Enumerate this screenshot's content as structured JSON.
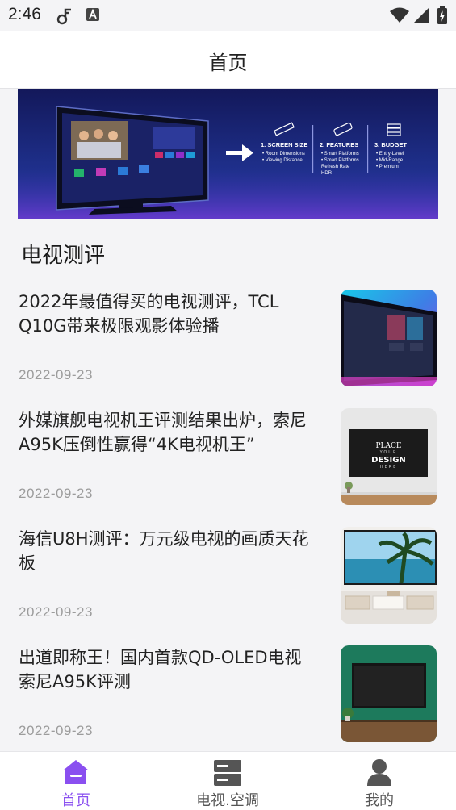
{
  "status_bar": {
    "time": "2:46"
  },
  "header": {
    "title": "首页"
  },
  "banner": {
    "steps": [
      {
        "title": "1. SCREEN SIZE",
        "items": [
          "• Room Dimensions",
          "• Viewing Distance"
        ]
      },
      {
        "title": "2. FEATURES",
        "items": [
          "• Smart Platforms",
          "• Smart Platforms",
          "  Refresh Rate",
          "  HDR"
        ]
      },
      {
        "title": "3. BUDGET",
        "items": [
          "• Entry-Level",
          "• Mid-Range",
          "• Premium"
        ]
      }
    ]
  },
  "section": {
    "title": "电视测评"
  },
  "articles": [
    {
      "title": "2022年最值得买的电视测评，TCL Q10G带来极限观影体验播",
      "date": "2022-09-23"
    },
    {
      "title": "外媒旗舰电视机王评测结果出炉，索尼A95K压倒性赢得“4K电视机王”",
      "date": "2022-09-23",
      "thumb_text": [
        "PLACE",
        "YOUR",
        "DESIGN",
        "HERE"
      ]
    },
    {
      "title": "海信U8H测评：万元级电视的画质天花板",
      "date": "2022-09-23"
    },
    {
      "title": "出道即称王！国内首款QD-OLED电视索尼A95K评测",
      "date": "2022-09-23"
    }
  ],
  "bottom_nav": {
    "items": [
      {
        "label": "首页",
        "icon": "home-icon",
        "active": true
      },
      {
        "label": "电视.空调",
        "icon": "appliance-icon",
        "active": false
      },
      {
        "label": "我的",
        "icon": "user-icon",
        "active": false
      }
    ]
  },
  "colors": {
    "accent": "#8a4ff0",
    "inactive": "#555555",
    "date": "#9c9c9c"
  }
}
